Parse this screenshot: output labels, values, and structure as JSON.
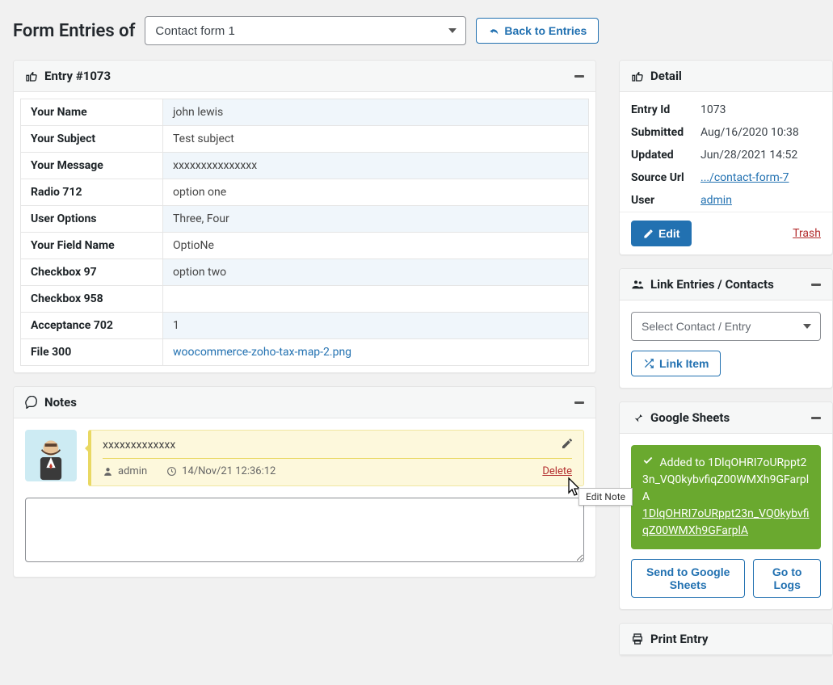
{
  "header": {
    "page_title": "Form Entries of",
    "selected_form": "Contact form 1",
    "back_label": "Back to Entries"
  },
  "entry_panel": {
    "title": "Entry #1073",
    "rows": [
      {
        "label": "Your Name",
        "value": "john lewis"
      },
      {
        "label": "Your Subject",
        "value": "Test subject"
      },
      {
        "label": "Your Message",
        "value": "xxxxxxxxxxxxxxx"
      },
      {
        "label": "Radio 712",
        "value": "option one"
      },
      {
        "label": "User Options",
        "value": "Three, Four"
      },
      {
        "label": "Your Field Name",
        "value": "OptioNe"
      },
      {
        "label": "Checkbox 97",
        "value": "option two"
      },
      {
        "label": "Checkbox 958",
        "value": ""
      },
      {
        "label": "Acceptance 702",
        "value": "1"
      },
      {
        "label": "File 300",
        "value": "woocommerce-zoho-tax-map-2.png",
        "is_link": true
      }
    ]
  },
  "notes_panel": {
    "title": "Notes",
    "note_text": "xxxxxxxxxxxxx",
    "note_author": "admin",
    "note_date": "14/Nov/21 12:36:12",
    "delete_label": "Delete",
    "edit_tooltip": "Edit Note"
  },
  "detail_panel": {
    "title": "Detail",
    "rows": {
      "entry_id_label": "Entry Id",
      "entry_id": "1073",
      "submitted_label": "Submitted",
      "submitted": "Aug/16/2020 10:38",
      "updated_label": "Updated",
      "updated": "Jun/28/2021 14:52",
      "source_label": "Source Url",
      "source": ".../contact-form-7",
      "user_label": "User",
      "user": "admin"
    },
    "edit_label": "Edit",
    "trash_label": "Trash"
  },
  "link_panel": {
    "title": "Link Entries / Contacts",
    "placeholder": "Select Contact / Entry",
    "link_item_label": "Link Item"
  },
  "sheets_panel": {
    "title": "Google Sheets",
    "added_label": "Added to",
    "sheet_id": "1DlqOHRI7oURppt23n_VQ0kybvfiqZ00WMXh9GFarplA",
    "send_label": "Send to Google Sheets",
    "logs_label": "Go to Logs"
  },
  "print_panel": {
    "title": "Print Entry"
  }
}
